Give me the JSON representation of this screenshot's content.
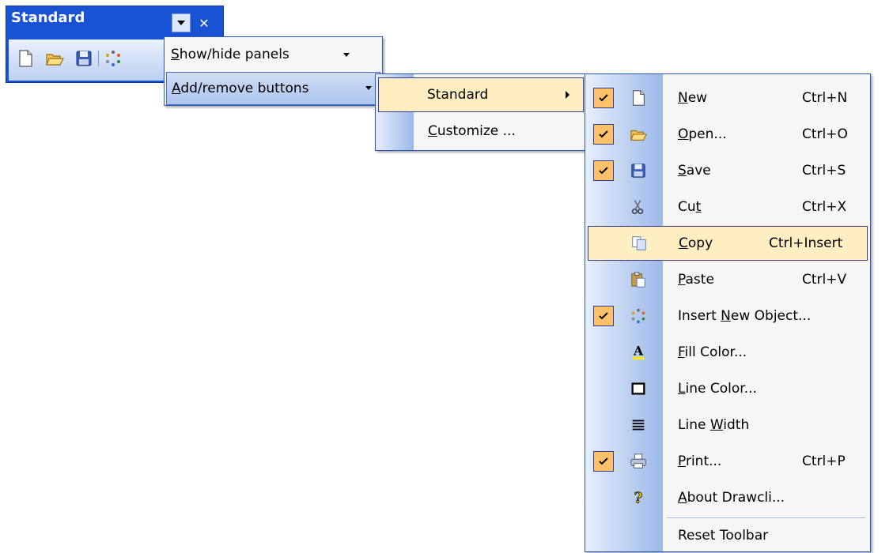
{
  "toolbar": {
    "title": "Standard",
    "dropdown_icon": "chevron-down-icon",
    "close_label": "✕",
    "buttons": [
      {
        "name": "new-icon"
      },
      {
        "name": "open-folder-icon"
      },
      {
        "name": "save-disk-icon"
      },
      {
        "name": "insert-object-icon"
      }
    ]
  },
  "options_menu": {
    "items": [
      {
        "prefix": "",
        "accel": "S",
        "rest": "how/hide panels"
      },
      {
        "prefix": "",
        "accel": "A",
        "rest": "dd/remove buttons"
      }
    ]
  },
  "submenu": {
    "items": [
      {
        "label": "Standard"
      },
      {
        "prefix": "",
        "accel": "C",
        "rest": "ustomize ..."
      }
    ]
  },
  "buttons_menu": {
    "items": [
      {
        "checked": true,
        "icon": "new-icon",
        "pre": "",
        "acc": "N",
        "post": "ew",
        "shortcut": "Ctrl+N"
      },
      {
        "checked": true,
        "icon": "open-folder-icon",
        "pre": "",
        "acc": "O",
        "post": "pen...",
        "shortcut": "Ctrl+O"
      },
      {
        "checked": true,
        "icon": "save-disk-icon",
        "pre": "",
        "acc": "S",
        "post": "ave",
        "shortcut": "Ctrl+S"
      },
      {
        "checked": false,
        "icon": "scissors-icon",
        "pre": "Cu",
        "acc": "t",
        "post": "",
        "shortcut": "Ctrl+X"
      },
      {
        "checked": false,
        "icon": "copy-icon",
        "pre": "",
        "acc": "C",
        "post": "opy",
        "shortcut": "Ctrl+Insert",
        "highlighted": true
      },
      {
        "checked": false,
        "icon": "paste-icon",
        "pre": "",
        "acc": "P",
        "post": "aste",
        "shortcut": "Ctrl+V"
      },
      {
        "checked": true,
        "icon": "insert-object-icon",
        "pre": "Insert ",
        "acc": "N",
        "post": "ew Object...",
        "shortcut": ""
      },
      {
        "checked": false,
        "icon": "fill-color-icon",
        "pre": "",
        "acc": "F",
        "post": "ill Color...",
        "shortcut": ""
      },
      {
        "checked": false,
        "icon": "line-color-icon",
        "pre": "",
        "acc": "L",
        "post": "ine Color...",
        "shortcut": ""
      },
      {
        "checked": false,
        "icon": "line-width-icon",
        "pre": "Line ",
        "acc": "W",
        "post": "idth",
        "shortcut": ""
      },
      {
        "checked": true,
        "icon": "printer-icon",
        "pre": "",
        "acc": "P",
        "post": "rint...",
        "shortcut": "Ctrl+P"
      },
      {
        "checked": false,
        "icon": "help-question-icon",
        "pre": "",
        "acc": "A",
        "post": "bout Drawcli...",
        "shortcut": ""
      }
    ],
    "reset_label": "Reset Toolbar"
  },
  "colors": {
    "titlebar": "#1a52d4",
    "highlight": "#ffeec2",
    "check_bg": "#ffc26b",
    "menu_bg": "#f6f6f6"
  }
}
